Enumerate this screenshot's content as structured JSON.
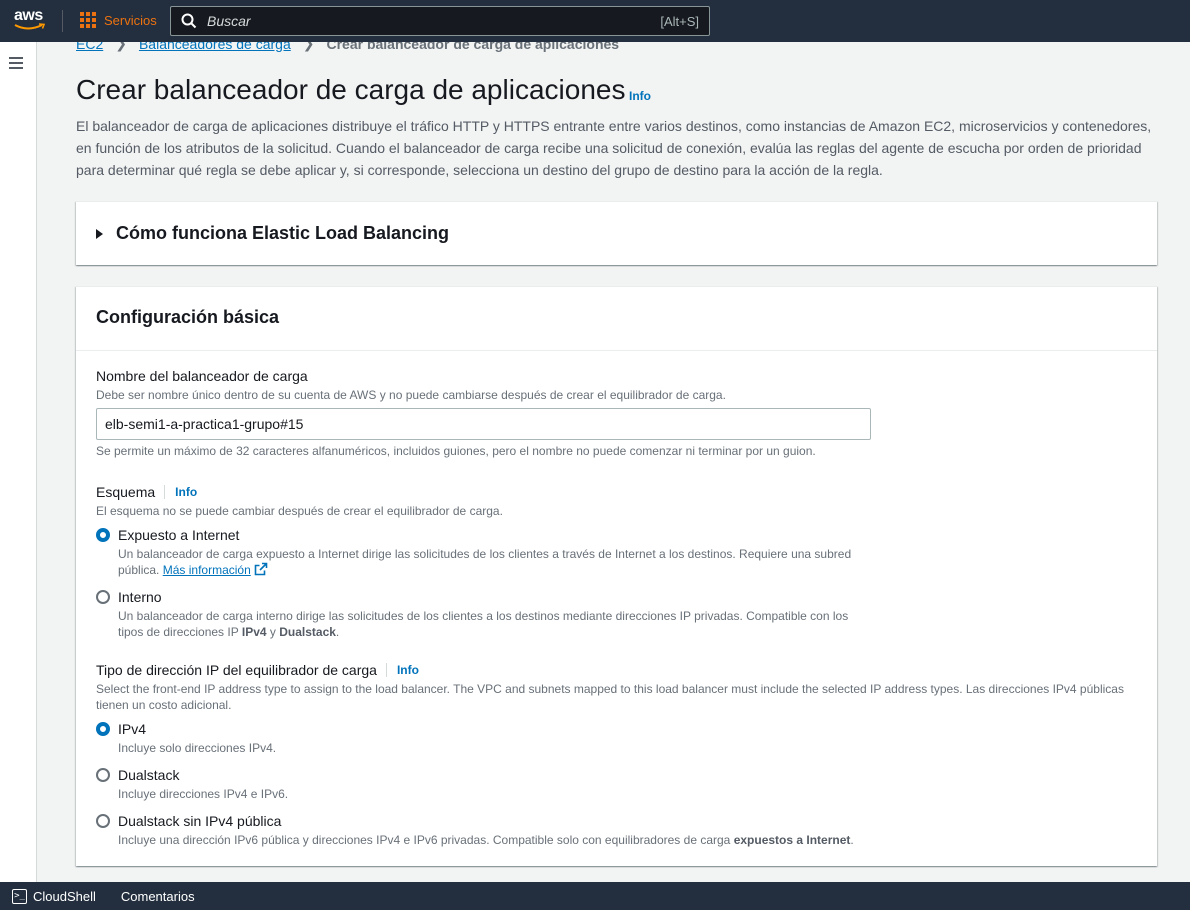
{
  "topnav": {
    "logo_text": "aws",
    "services_label": "Servicios",
    "search_placeholder": "Buscar",
    "search_shortcut": "[Alt+S]"
  },
  "breadcrumb": {
    "items": [
      "EC2",
      "Balanceadores de carga"
    ],
    "current": "Crear balanceador de carga de aplicaciones"
  },
  "page": {
    "title": "Crear balanceador de carga de aplicaciones",
    "info": "Info",
    "description": "El balanceador de carga de aplicaciones distribuye el tráfico HTTP y HTTPS entrante entre varios destinos, como instancias de Amazon EC2, microservicios y contenedores, en función de los atributos de la solicitud. Cuando el balanceador de carga recibe una solicitud de conexión, evalúa las reglas del agente de escucha por orden de prioridad para determinar qué regla se debe aplicar y, si corresponde, selecciona un destino del grupo de destino para la acción de la regla."
  },
  "expander": {
    "title": "Cómo funciona Elastic Load Balancing"
  },
  "config": {
    "title": "Configuración básica",
    "name_field": {
      "label": "Nombre del balanceador de carga",
      "description": "Debe ser nombre único dentro de su cuenta de AWS y no puede cambiarse después de crear el equilibrador de carga.",
      "value": "elb-semi1-a-practica1-grupo#15",
      "hint": "Se permite un máximo de 32 caracteres alfanuméricos, incluidos guiones, pero el nombre no puede comenzar ni terminar por un guion."
    },
    "scheme": {
      "label": "Esquema",
      "info": "Info",
      "description": "El esquema no se puede cambiar después de crear el equilibrador de carga.",
      "options": [
        {
          "label": "Expuesto a Internet",
          "selected": true,
          "description": "Un balanceador de carga expuesto a Internet dirige las solicitudes de los clientes a través de Internet a los destinos. Requiere una subred pública.",
          "link": "Más información"
        },
        {
          "label": "Interno",
          "selected": false,
          "description_prefix": "Un balanceador de carga interno dirige las solicitudes de los clientes a los destinos mediante direcciones IP privadas. Compatible con los tipos de direcciones IP ",
          "bold_1": "IPv4",
          "middle": " y ",
          "bold_2": "Dualstack",
          "suffix": "."
        }
      ]
    },
    "ip_type": {
      "label": "Tipo de dirección IP del equilibrador de carga",
      "info": "Info",
      "description": "Select the front-end IP address type to assign to the load balancer. The VPC and subnets mapped to this load balancer must include the selected IP address types. Las direcciones IPv4 públicas tienen un costo adicional.",
      "options": [
        {
          "label": "IPv4",
          "selected": true,
          "description": "Incluye solo direcciones IPv4."
        },
        {
          "label": "Dualstack",
          "selected": false,
          "description": "Incluye direcciones IPv4 e IPv6."
        },
        {
          "label": "Dualstack sin IPv4 pública",
          "selected": false,
          "description_prefix": "Incluye una dirección IPv6 pública y direcciones IPv4 e IPv6 privadas. Compatible solo con equilibradores de carga ",
          "bold": "expuestos a Internet",
          "suffix": "."
        }
      ]
    }
  },
  "bottombar": {
    "cloudshell": "CloudShell",
    "feedback": "Comentarios"
  },
  "colors": {
    "nav_bg": "#232f3e",
    "accent_orange": "#ec7211",
    "link_blue": "#0073bb"
  }
}
